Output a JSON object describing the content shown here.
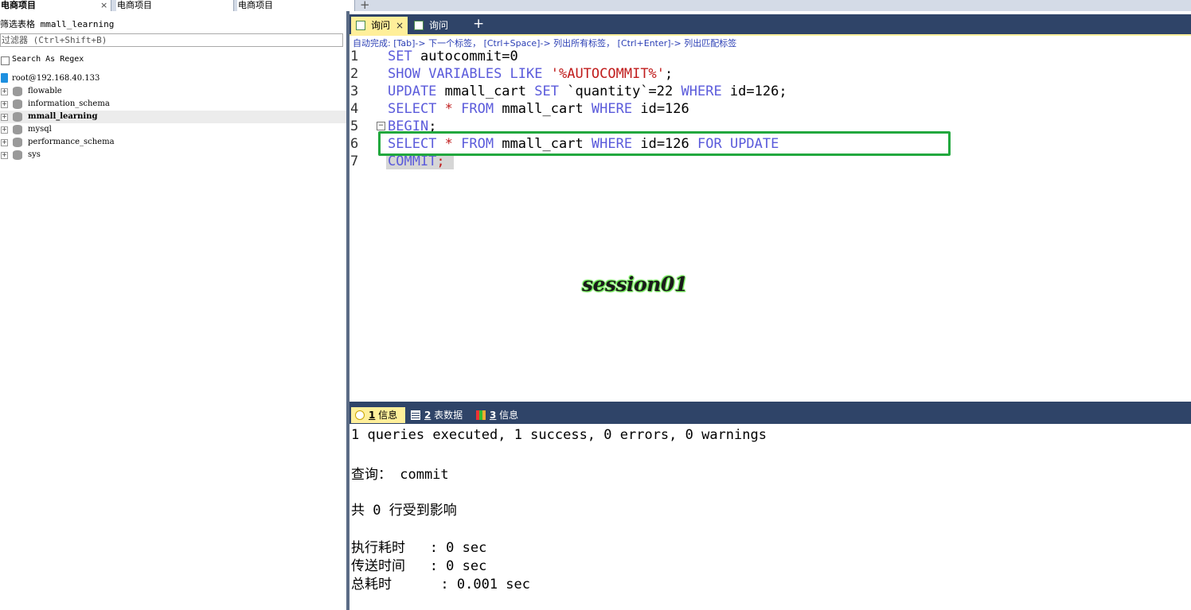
{
  "connection_tabs": [
    {
      "label": "电商项目",
      "active": true
    },
    {
      "label": "电商项目",
      "active": false
    },
    {
      "label": "电商项目",
      "active": false
    }
  ],
  "connection_tab_close": "×",
  "connection_tab_add": "+",
  "browser": {
    "filter_label": "筛选表格 mmall_learning",
    "filter_placeholder": "过滤器 (Ctrl+Shift+B)",
    "regex_label": "Search As Regex",
    "server": "root@192.168.40.133",
    "databases": [
      {
        "name": "flowable",
        "selected": false
      },
      {
        "name": "information_schema",
        "selected": false
      },
      {
        "name": "mmall_learning",
        "selected": true
      },
      {
        "name": "mysql",
        "selected": false
      },
      {
        "name": "performance_schema",
        "selected": false
      },
      {
        "name": "sys",
        "selected": false
      }
    ],
    "expander_glyph": "+"
  },
  "query_tabs": [
    {
      "label": "询问",
      "active": true
    },
    {
      "label": "询问",
      "active": false
    }
  ],
  "query_tab_close": "×",
  "query_tab_add": "+",
  "autocomplete_hint": "自动完成: [Tab]-> 下一个标签， [Ctrl+Space]-> 列出所有标签， [Ctrl+Enter]-> 列出匹配标签",
  "editor": {
    "lines": [
      {
        "no": "1"
      },
      {
        "no": "2"
      },
      {
        "no": "3"
      },
      {
        "no": "4"
      },
      {
        "no": "5"
      },
      {
        "no": "6"
      },
      {
        "no": "7"
      }
    ],
    "fold_glyph": "−",
    "line1": {
      "kw1": "SET",
      "rest": " autocommit=0"
    },
    "line2": {
      "kw1": "SHOW",
      "kw2": " VARIABLES",
      "kw3": " LIKE",
      "str": " '%AUTOCOMMIT%'",
      "end": ";"
    },
    "line3": {
      "kw1": "UPDATE",
      "t1": " mmall_cart ",
      "kw2": "SET",
      "t2": " `quantity`=22 ",
      "kw3": "WHERE",
      "t3": " id=126",
      "end": ";"
    },
    "line4": {
      "kw1": "SELECT",
      "op": " *",
      "kw2": " FROM",
      "t1": " mmall_cart ",
      "kw3": "WHERE",
      "t2": " id=126"
    },
    "line5": {
      "kw1": "BEGIN",
      "end": ";"
    },
    "line6": {
      "kw1": "SELECT",
      "op": " *",
      "kw2": " FROM",
      "t1": " mmall_cart ",
      "kw3": "WHERE",
      "t2": " id=126 ",
      "kw4": "FOR",
      "kw5": " UPDATE"
    },
    "line7": {
      "kw1": "COMMIT",
      "end": ";"
    }
  },
  "annotation_text": "session01",
  "annotation_color": "#22a83e",
  "result_tabs": [
    {
      "num": "1",
      "label": " 信息",
      "active": true
    },
    {
      "num": "2",
      "label": " 表数据",
      "active": false
    },
    {
      "num": "3",
      "label": " 信息",
      "active": false
    }
  ],
  "output": {
    "summary": "1 queries executed, 1 success, 0 errors, 0 warnings",
    "query": "查询： commit",
    "affected": "共 0 行受到影响",
    "exec_time": "执行耗时   : 0 sec",
    "transfer_time": "传送时间   : 0 sec",
    "total_time": "总耗时      : 0.001 sec"
  }
}
